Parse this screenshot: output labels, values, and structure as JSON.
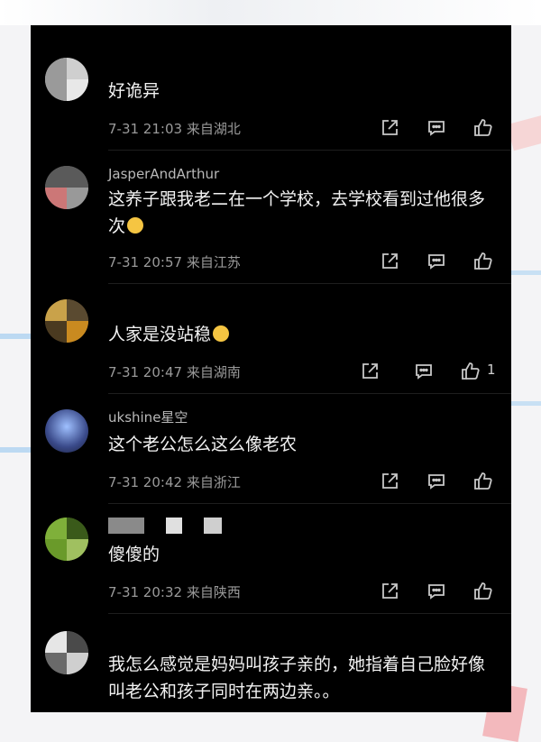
{
  "comments": [
    {
      "username": "",
      "text": "好诡异",
      "time": "7-31 21:03",
      "location": "来自湖北",
      "likes": ""
    },
    {
      "username": "JasperAndArthur",
      "text": "这养子跟我老二在一个学校，去学校看到过他很多次",
      "time": "7-31 20:57",
      "location": "来自江苏",
      "likes": ""
    },
    {
      "username": "",
      "text": "人家是没站稳",
      "time": "7-31 20:47",
      "location": "来自湖南",
      "likes": "1"
    },
    {
      "username": "ukshine星空",
      "text": "这个老公怎么这么像老农",
      "time": "7-31 20:42",
      "location": "来自浙江",
      "likes": ""
    },
    {
      "username": "",
      "text": "傻傻的",
      "time": "7-31 20:32",
      "location": "来自陕西",
      "likes": ""
    },
    {
      "username": "",
      "text": "我怎么感觉是妈妈叫孩子亲的，她指着自己脸好像叫老公和孩子同时在两边亲。。",
      "time": "",
      "location": "",
      "likes": ""
    }
  ],
  "icons": {
    "share": "share-icon",
    "reply": "comment-icon",
    "like": "thumbs-up-icon"
  },
  "colors": {
    "panel_bg": "#000000",
    "text": "#f2f2f2",
    "meta": "#9a9a9a"
  }
}
